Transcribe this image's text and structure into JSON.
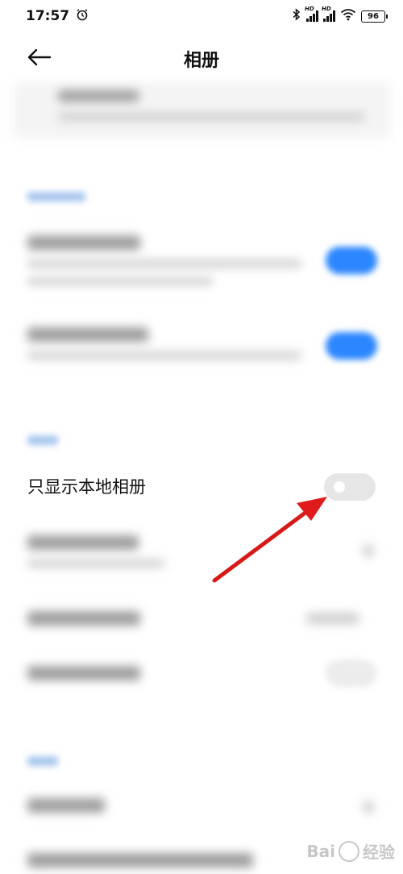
{
  "status_bar": {
    "time": "17:57",
    "battery": "96",
    "signal_label": "HD",
    "icons": [
      "alarm-icon",
      "bluetooth-icon",
      "signal-icon",
      "signal-icon",
      "wifi-icon",
      "battery-icon"
    ]
  },
  "header": {
    "title": "相册",
    "back_icon": "arrow-left-icon"
  },
  "focused_setting": {
    "label": "只显示本地相册",
    "enabled": false
  },
  "watermark": {
    "brand": "Bai",
    "suffix": "经验"
  },
  "colors": {
    "toggle_on": "#2c86ff",
    "toggle_off": "#e6e6e6",
    "arrow": "#e01b1b"
  }
}
